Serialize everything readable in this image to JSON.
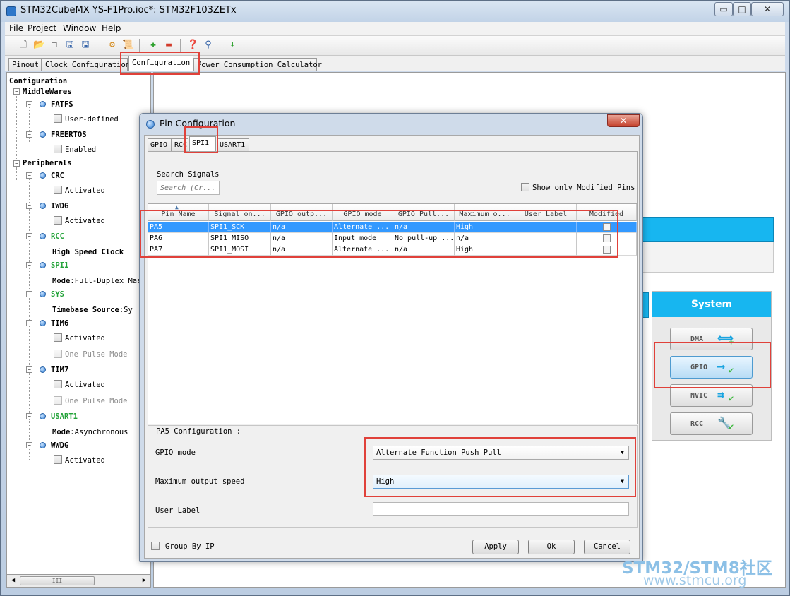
{
  "window": {
    "title": "STM32CubeMX YS-F1Pro.ioc*: STM32F103ZETx",
    "min": "▭",
    "max": "□",
    "close": "✕"
  },
  "menu": [
    "File",
    "Project",
    "Window",
    "Help"
  ],
  "tabs": [
    "Pinout",
    "Clock Configuration",
    "Configuration",
    "Power Consumption Calculator"
  ],
  "tree": {
    "root": "Configuration",
    "middlewares": "MiddleWares",
    "fatfs": "FATFS",
    "fatfs_opt": "User-defined",
    "freertos": "FREERTOS",
    "freertos_opt": "Enabled",
    "peripherals": "Peripherals",
    "crc": "CRC",
    "crc_opt": "Activated",
    "iwdg": "IWDG",
    "iwdg_opt": "Activated",
    "rcc": "RCC",
    "rcc_opt": "High Speed Clock",
    "spi1": "SPI1",
    "spi1_mode_label": "Mode",
    "spi1_mode_value": ":Full-Duplex Mas",
    "sys": "SYS",
    "sys_tb_label": "Timebase Source",
    "sys_tb_value": ":Sy",
    "tim6": "TIM6",
    "tim6_opt1": "Activated",
    "tim6_opt2": "One Pulse Mode",
    "tim7": "TIM7",
    "tim7_opt1": "Activated",
    "tim7_opt2": "One Pulse Mode",
    "usart1": "USART1",
    "usart1_mode_label": "Mode",
    "usart1_mode_value": ":Asynchronous",
    "wwdg": "WWDG",
    "wwdg_opt": "Activated",
    "scroll_thumb": "III"
  },
  "system_panel": {
    "title": "System",
    "buttons": [
      "DMA",
      "GPIO",
      "NVIC",
      "RCC"
    ]
  },
  "dialog": {
    "title": "Pin Configuration",
    "close": "✕",
    "tabs": [
      "GPIO",
      "RCC",
      "SPI1",
      "USART1"
    ],
    "search_label": "Search Signals",
    "search_placeholder": "Search (Cr...",
    "show_modified": "Show only Modified Pins",
    "columns": [
      "Pin Name",
      "Signal on...",
      "GPIO outp...",
      "GPIO mode",
      "GPIO Pull...",
      "Maximum o...",
      "User Label",
      "Modified"
    ],
    "rows": [
      [
        "PA5",
        "SPI1_SCK",
        "n/a",
        "Alternate ...",
        "n/a",
        "High",
        ""
      ],
      [
        "PA6",
        "SPI1_MISO",
        "n/a",
        "Input mode",
        "No pull-up ...",
        "n/a",
        ""
      ],
      [
        "PA7",
        "SPI1_MOSI",
        "n/a",
        "Alternate ...",
        "n/a",
        "High",
        ""
      ]
    ],
    "config_title": "PA5 Configuration :",
    "gpio_mode_label": "GPIO mode",
    "gpio_mode_value": "Alternate Function Push Pull",
    "speed_label": "Maximum output speed",
    "speed_value": "High",
    "user_label_label": "User Label",
    "group_by_ip": "Group By IP",
    "apply": "Apply",
    "ok": "Ok",
    "cancel": "Cancel"
  },
  "watermark": {
    "line1": "STM32/STM8社区",
    "line2": "www.stmcu.org"
  }
}
